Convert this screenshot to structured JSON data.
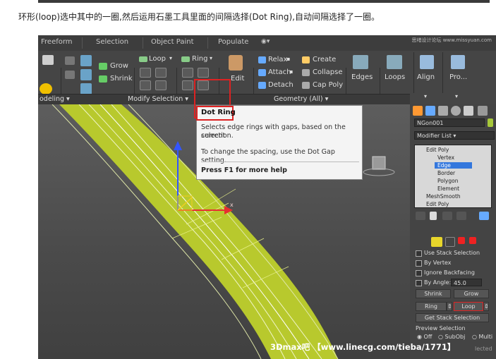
{
  "caption": "环形(loop)选中其中的一圈,然后运用石墨工具里面的间隔选择(Dot Ring),自动间隔选择了一圈。",
  "ribbon_tabs": [
    "Freeform",
    "Selection",
    "Object Paint",
    "Populate"
  ],
  "top_right_logo": "思绪设计论坛 www.missyuan.com",
  "ribbon": {
    "grow": "Grow",
    "shrink": "Shrink",
    "loop": "Loop",
    "ring": "Ring",
    "edit": "Edit",
    "relax": "Relax",
    "create": "Create",
    "attach": "Attach",
    "collapse": "Collapse",
    "detach": "Detach",
    "cap_poly": "Cap Poly",
    "edges": "Edges",
    "loops": "Loops",
    "align": "Align",
    "pro": "Pro...",
    "group_modeling": "odeling",
    "group_modify_selection": "Modify Selection",
    "group_geometry": "Geometry (All)"
  },
  "tooltip": {
    "title": "Dot Ring",
    "line1": "Selects edge rings with gaps, based on the current",
    "line2": "selection.",
    "line3": "To change the spacing, use the Dot Gap setting.",
    "help": "Press F1 for more help"
  },
  "command_panel": {
    "object_name": "NGon001",
    "modifier_list": "Modifier List",
    "stack": [
      "Edit Poly",
      "Vertex",
      "Edge",
      "Border",
      "Polygon",
      "Element",
      "MeshSmooth",
      "Edit Poly"
    ],
    "use_stack_selection": "Use Stack Selection",
    "by_vertex": "By Vertex",
    "ignore_backfacing": "Ignore Backfacing",
    "by_angle": "By Angle:",
    "by_angle_value": "45.0",
    "shrink": "Shrink",
    "grow": "Grow",
    "ring": "Ring",
    "loop": "Loop",
    "get_stack_selection": "Get Stack Selection",
    "preview_selection": "Preview Selection",
    "preview_off": "Off",
    "preview_subobj": "SubObj",
    "preview_multi": "Multi",
    "selected_suffix": "lected"
  },
  "axis_x": "x",
  "watermark": "3Dmax吧  【www.linecg.com/tieba/1771】"
}
